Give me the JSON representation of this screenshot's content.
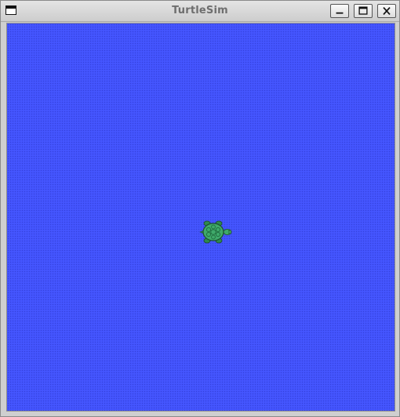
{
  "window": {
    "title": "TurtleSim",
    "controls": {
      "minimize": "minimize-icon",
      "maximize": "maximize-icon",
      "close": "close-icon"
    }
  },
  "canvas": {
    "background_color": "#4556ff",
    "turtle": {
      "icon": "turtle-icon",
      "shell_color": "#3fa96a",
      "heading": "east"
    }
  }
}
